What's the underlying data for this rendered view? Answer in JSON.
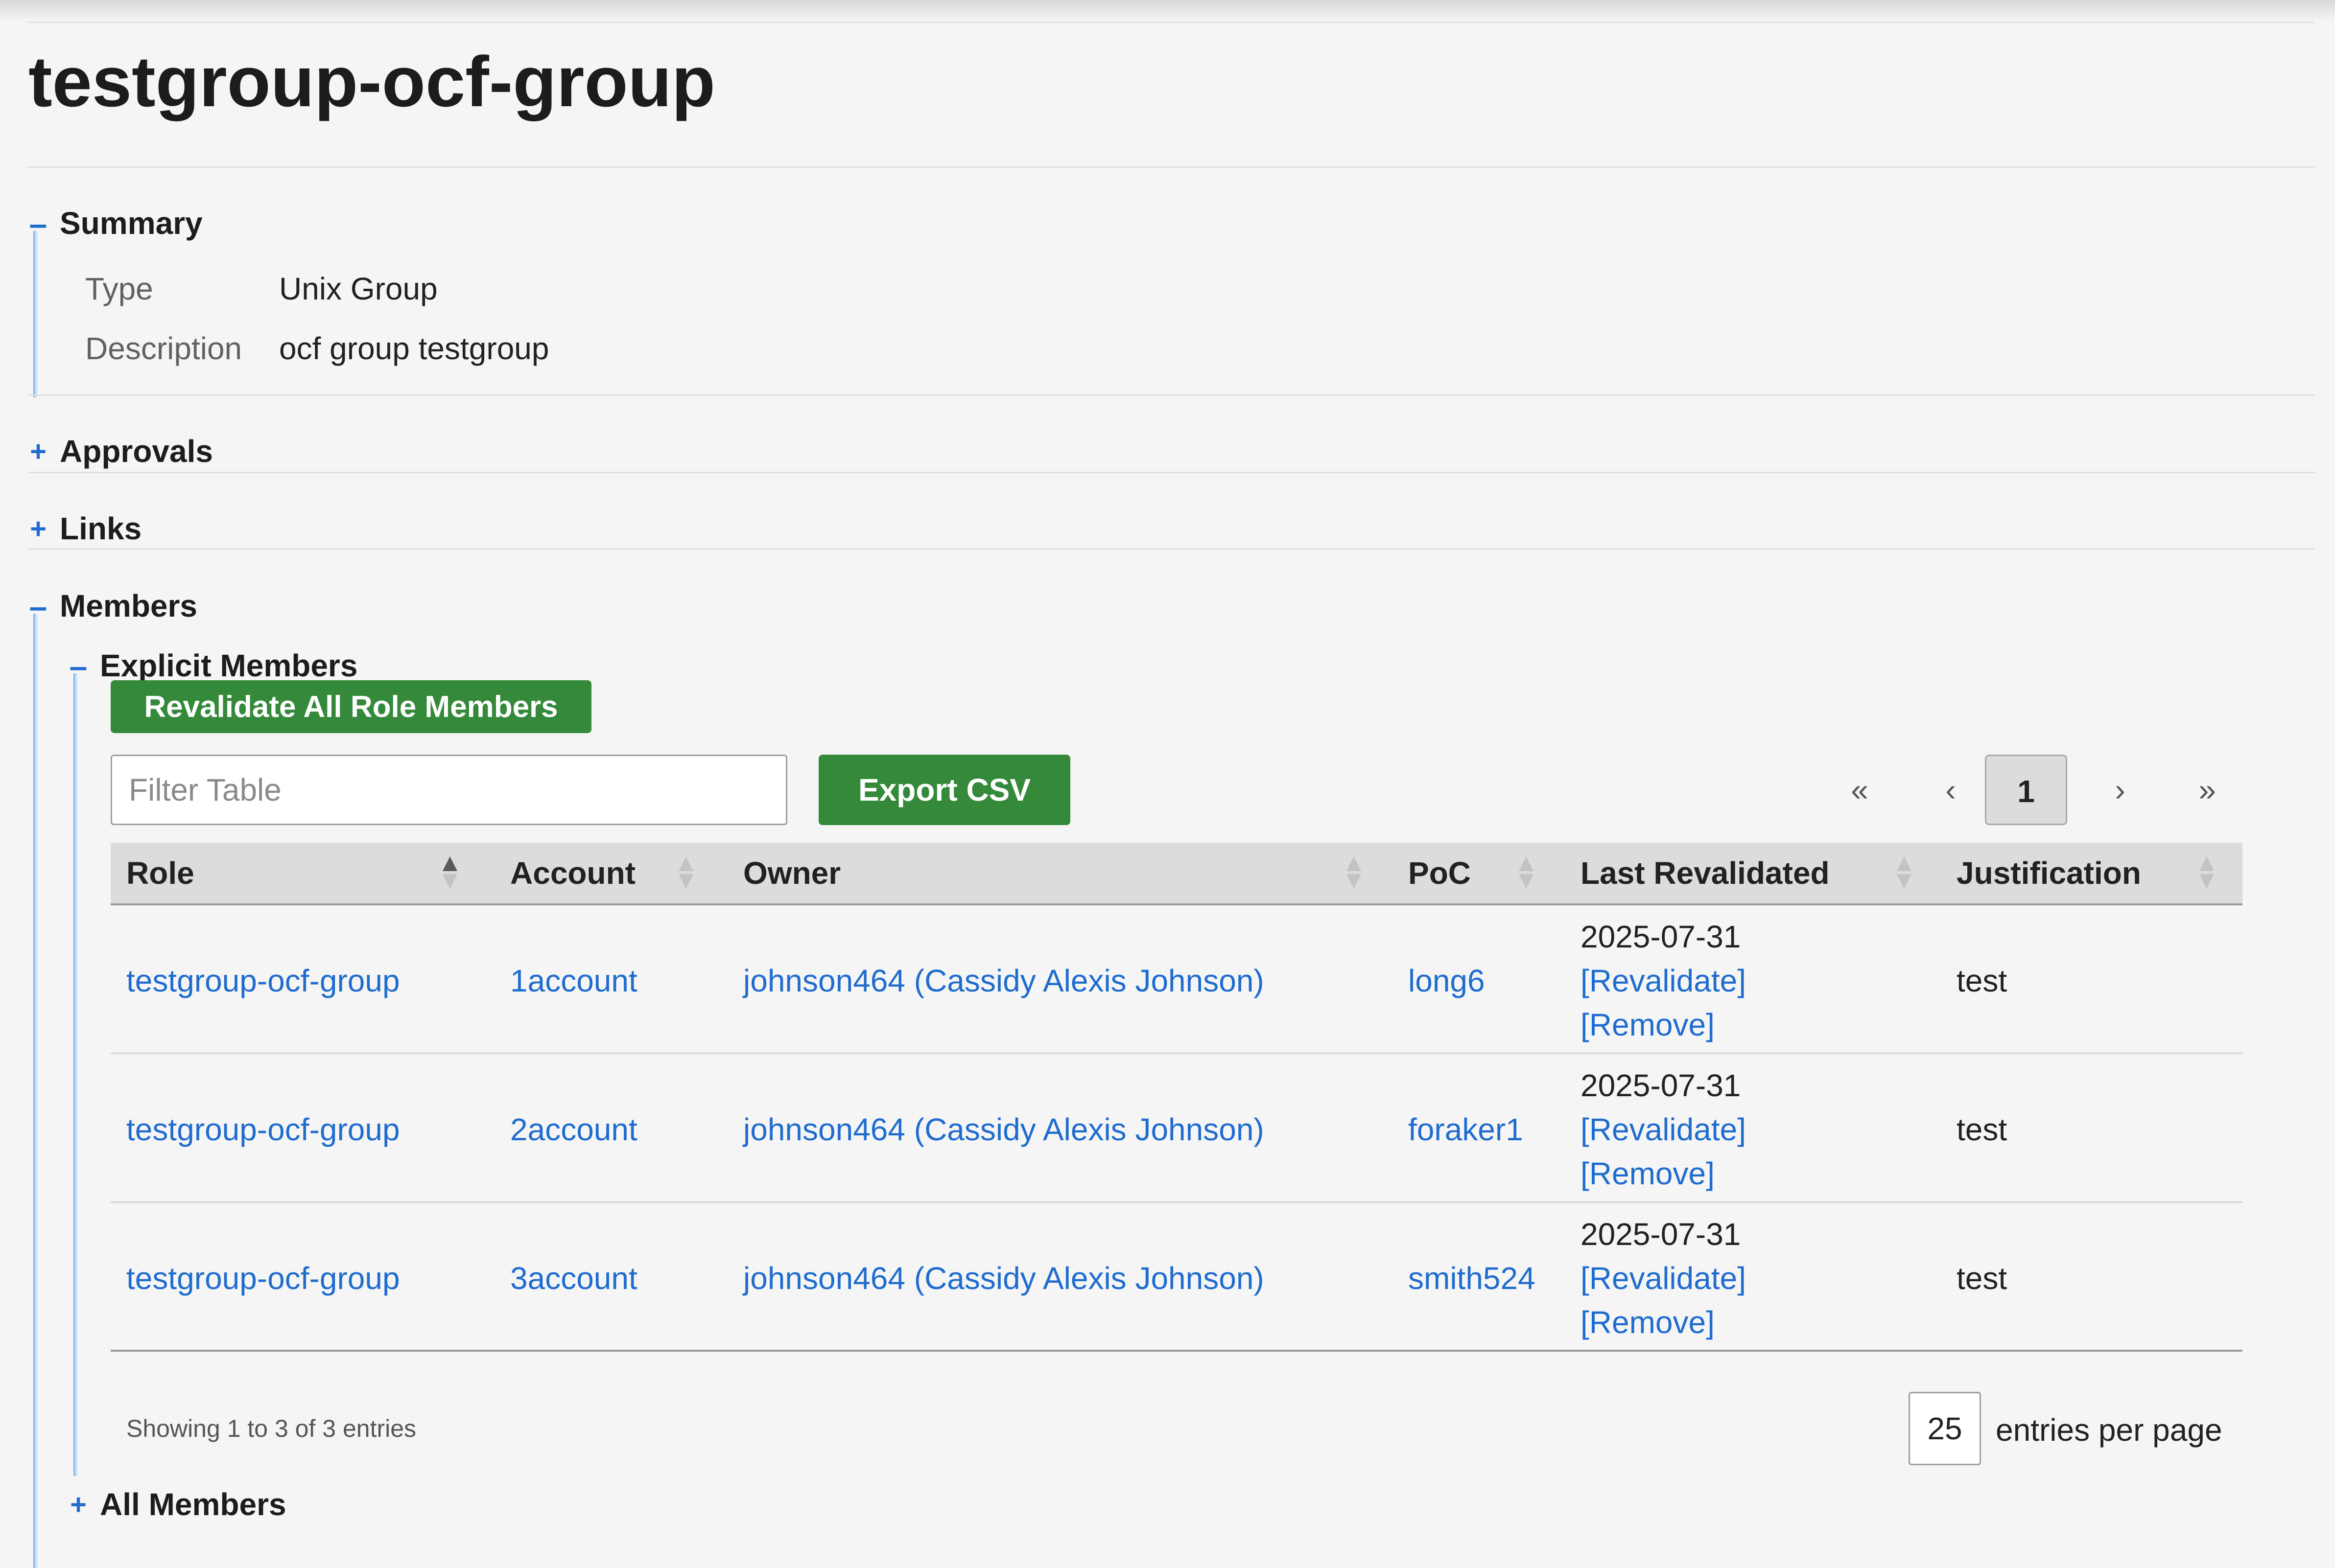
{
  "page": {
    "title": "testgroup-ocf-group"
  },
  "summary": {
    "toggle": "–",
    "label": "Summary",
    "type_key": "Type",
    "type_value": "Unix Group",
    "description_key": "Description",
    "description_value": "ocf group testgroup"
  },
  "approvals": {
    "toggle": "+",
    "label": "Approvals"
  },
  "links": {
    "toggle": "+",
    "label": "Links"
  },
  "members": {
    "toggle": "–",
    "label": "Members",
    "explicit": {
      "toggle": "–",
      "label": "Explicit Members",
      "revalidate_all_label": "Revalidate All Role Members",
      "filter_placeholder": "Filter Table",
      "export_label": "Export CSV",
      "pagination": {
        "first": "«",
        "prev": "‹",
        "current": "1",
        "next": "›",
        "last": "»"
      },
      "columns": [
        "Role",
        "Account",
        "Owner",
        "PoC",
        "Last Revalidated",
        "Justification"
      ],
      "rows": [
        {
          "role": "testgroup-ocf-group",
          "account": "1account",
          "owner": "johnson464 (Cassidy Alexis Johnson)",
          "poc": "long6",
          "last_revalidated": "2025-07-31",
          "revalidate": "[Revalidate]",
          "remove": "[Remove]",
          "justification": "test"
        },
        {
          "role": "testgroup-ocf-group",
          "account": "2account",
          "owner": "johnson464 (Cassidy Alexis Johnson)",
          "poc": "foraker1",
          "last_revalidated": "2025-07-31",
          "revalidate": "[Revalidate]",
          "remove": "[Remove]",
          "justification": "test"
        },
        {
          "role": "testgroup-ocf-group",
          "account": "3account",
          "owner": "johnson464 (Cassidy Alexis Johnson)",
          "poc": "smith524",
          "last_revalidated": "2025-07-31",
          "revalidate": "[Revalidate]",
          "remove": "[Remove]",
          "justification": "test"
        }
      ],
      "showing_text": "Showing 1 to 3 of 3 entries",
      "entries_per_page_value": "25",
      "entries_per_page_label": "entries per page"
    },
    "all": {
      "toggle": "+",
      "label": "All Members"
    }
  },
  "colors": {
    "link": "#1f6ccf",
    "button_green": "#348a3a",
    "accent_bar": "#7eb6ea"
  },
  "icons": {
    "sort": "sort-arrows-icon"
  }
}
